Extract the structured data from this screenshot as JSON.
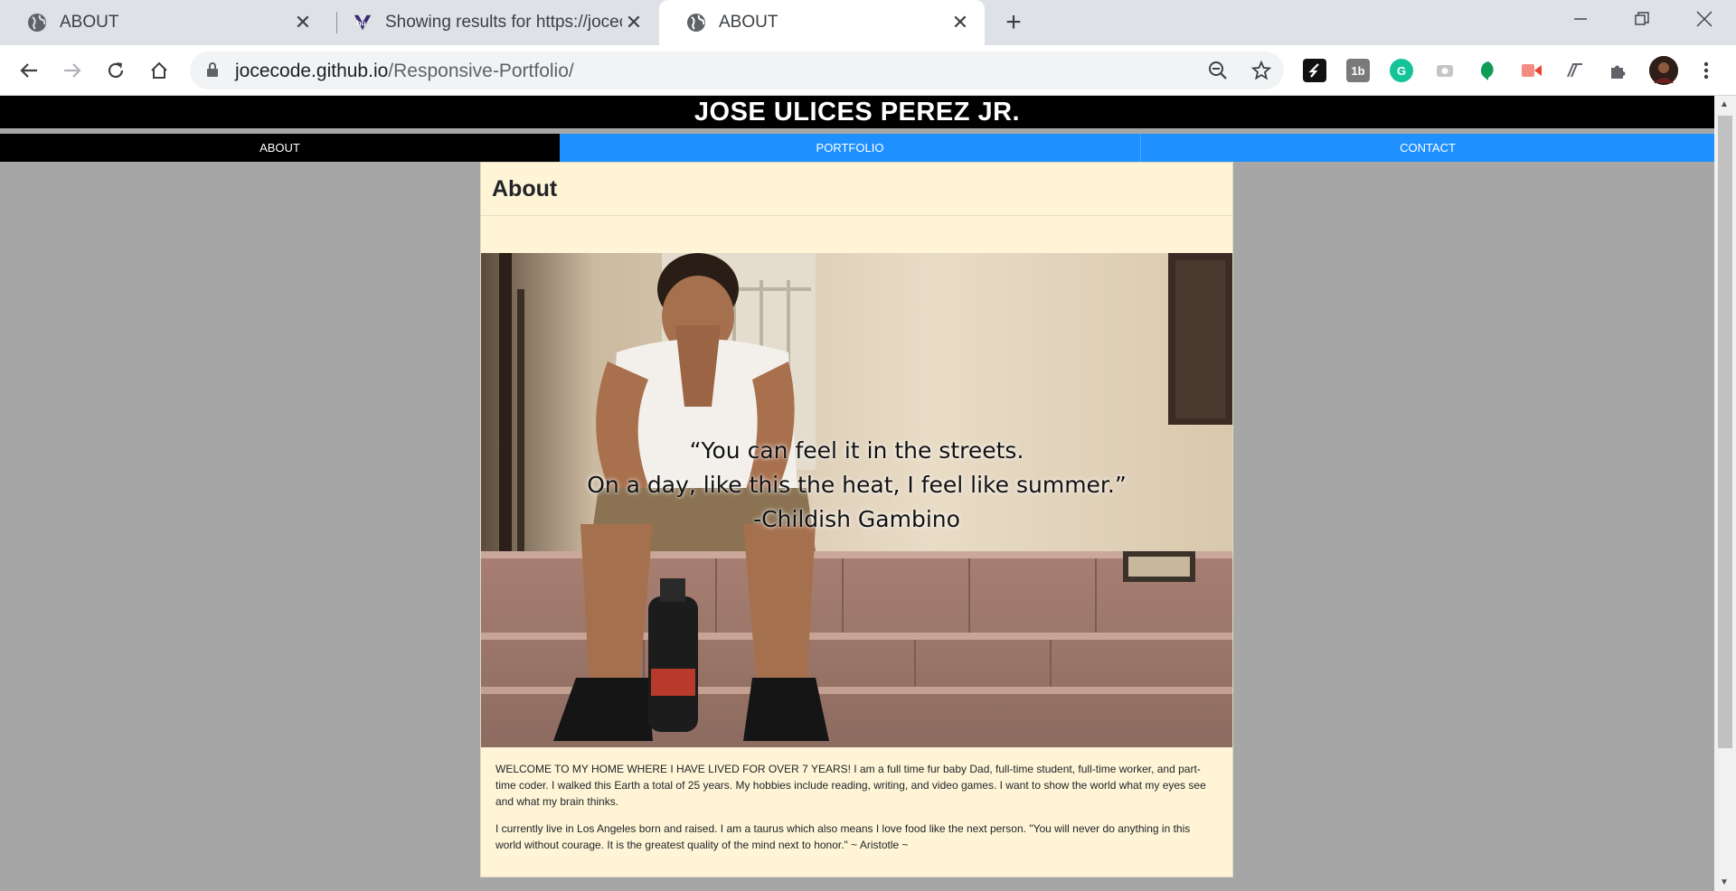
{
  "browser": {
    "tabs": [
      {
        "title": "ABOUT",
        "active": false
      },
      {
        "title": "Showing results for https://jocecode...",
        "active": false
      },
      {
        "title": "ABOUT",
        "active": true
      }
    ],
    "url_domain": "jocecode.github.io",
    "url_path": "/Responsive-Portfolio/"
  },
  "site": {
    "title": "JOSE ULICES PEREZ JR.",
    "nav": [
      {
        "label": "ABOUT"
      },
      {
        "label": "PORTFOLIO"
      },
      {
        "label": "CONTACT"
      }
    ]
  },
  "about": {
    "heading": "About",
    "quote_lines": [
      "“You can feel it in the streets.",
      "On a day, like this the heat, I feel like summer.”",
      "-Childish Gambino"
    ],
    "paragraphs": [
      "WELCOME TO MY HOME WHERE I HAVE LIVED FOR OVER 7 YEARS! I am a full time fur baby Dad, full-time student, full-time worker, and part-time coder. I walked this Earth a total of 25 years. My hobbies include reading, writing, and video games. I want to show the world what my eyes see and what my brain thinks.",
      "I currently live in Los Angeles born and raised. I am a taurus which also means I love food like the next person. \"You will never do anything in this world without courage. It is the greatest quality of the mind next to honor.\" ~ Aristotle ~"
    ]
  },
  "colors": {
    "header_bg": "#000000",
    "nav_active": "#000000",
    "nav_inactive": "#1e90ff",
    "card_bg": "#fff5d6",
    "page_bg": "#a6a6a6"
  }
}
